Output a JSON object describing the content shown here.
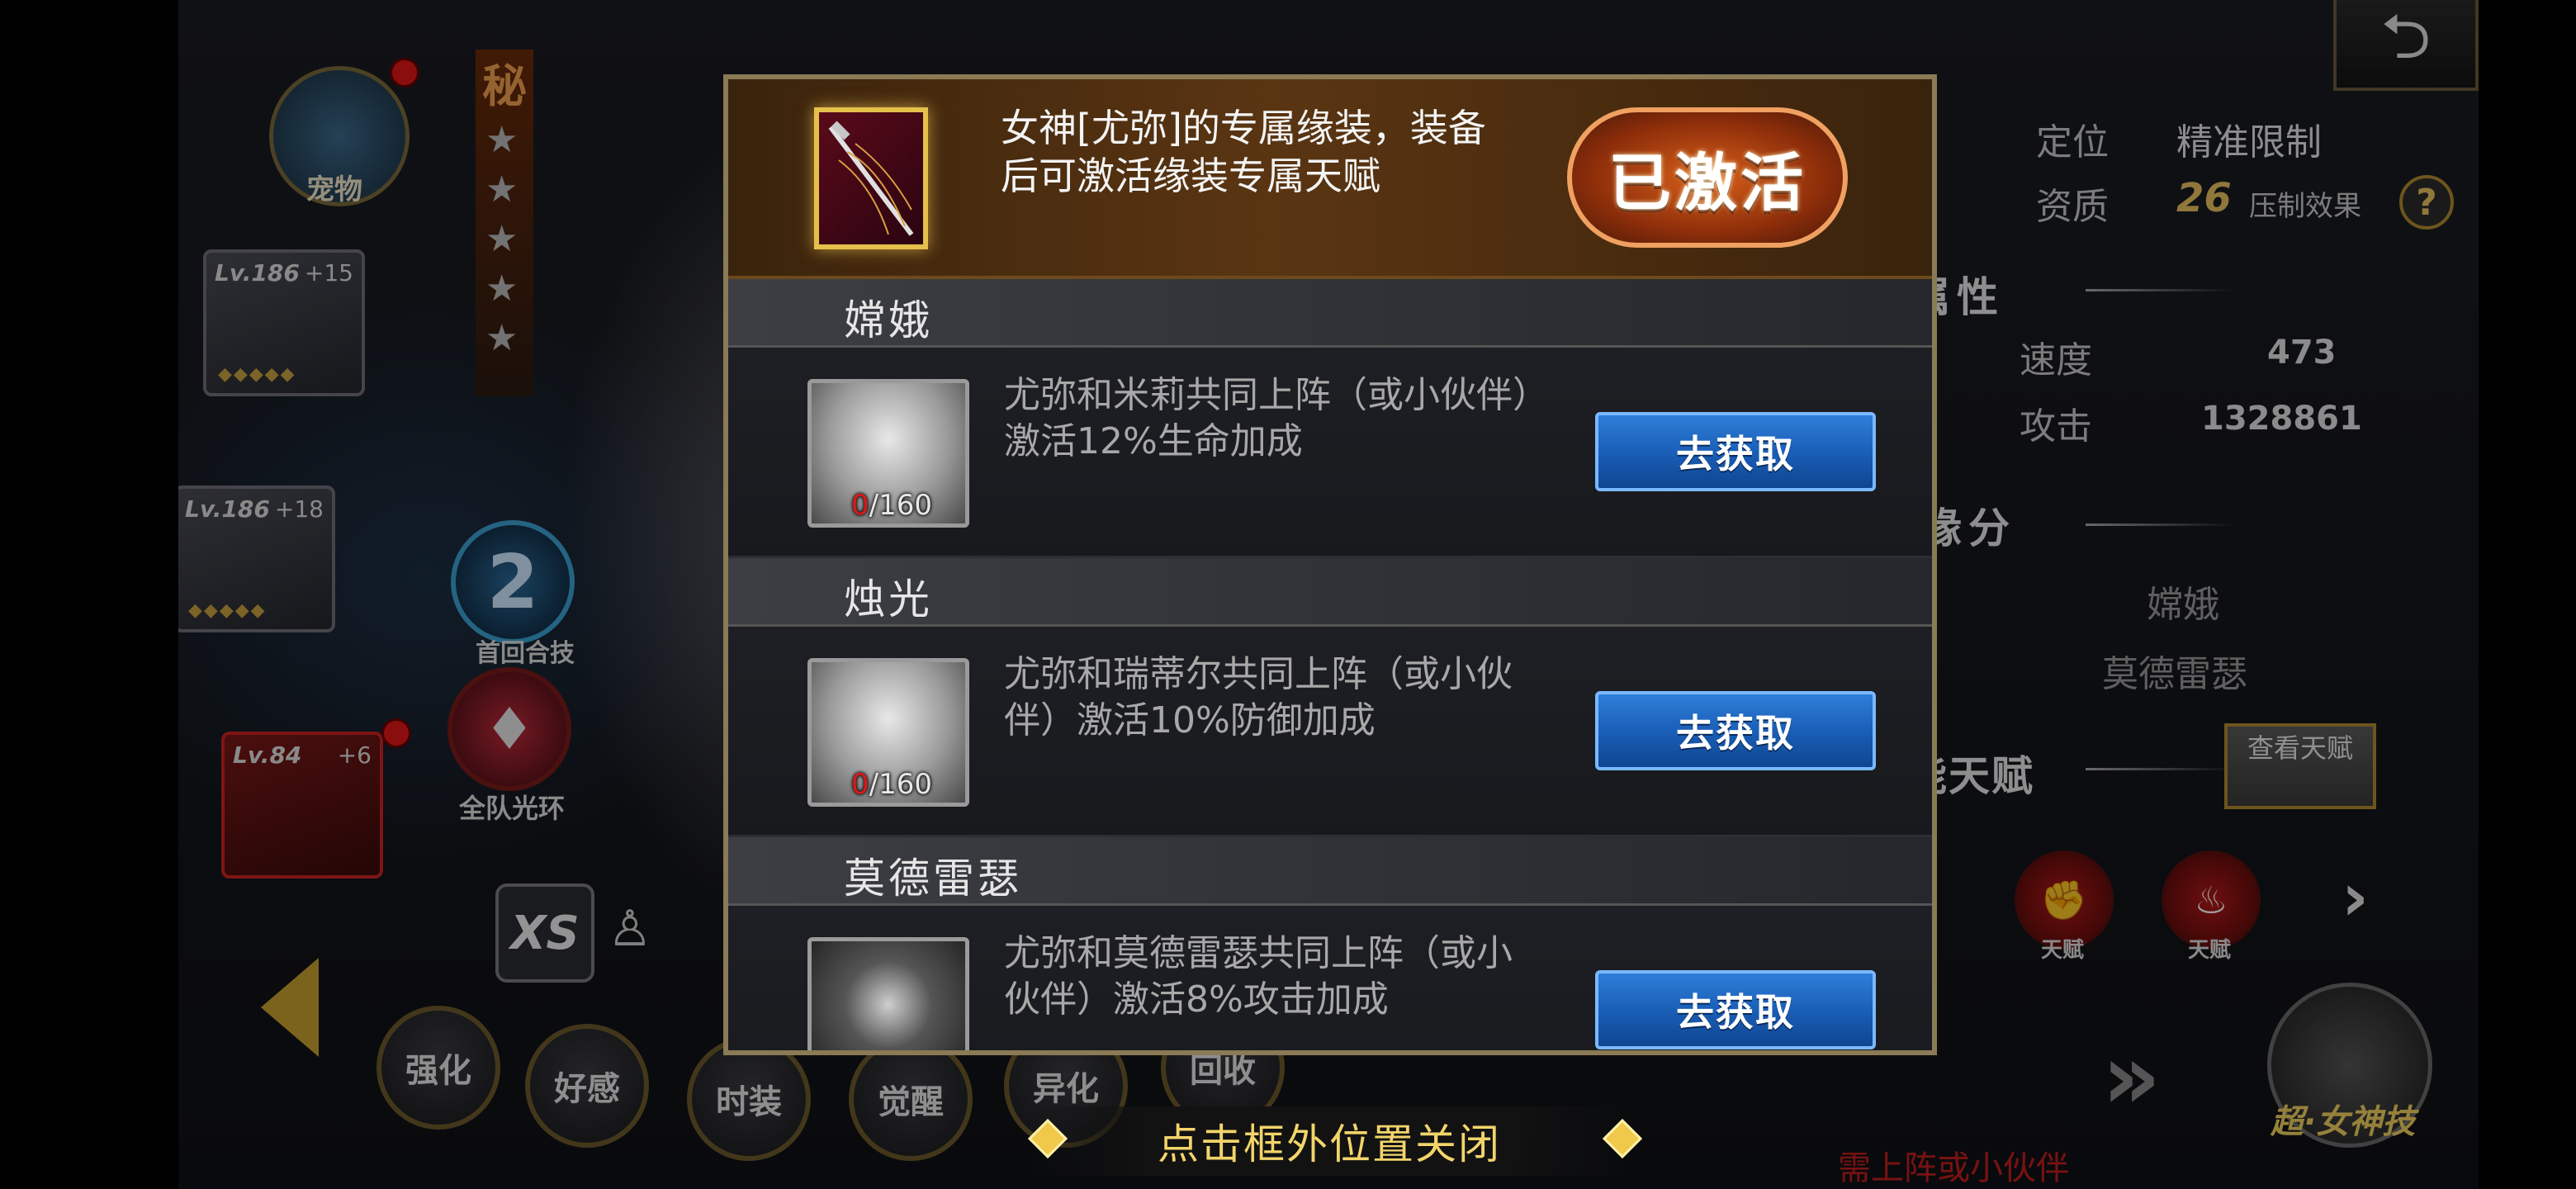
{
  "background": {
    "pet_label": "宠物",
    "secret_char": "秘",
    "equip_slots": [
      {
        "level": "Lv.186",
        "plus": "+15"
      },
      {
        "level": "Lv.186",
        "plus": "+18"
      },
      {
        "level": "Lv.84",
        "plus": "+6"
      }
    ],
    "combo_number": "2",
    "combo_label": "首回合技",
    "aura_label": "全队光环",
    "xs_label": "XS",
    "bottom_tabs": [
      "强化",
      "好感",
      "时装",
      "觉醒",
      "异化",
      "回收"
    ],
    "right_panel": {
      "position_label": "定位",
      "position_value": "精准限制",
      "aptitude_label": "资质",
      "aptitude_value": "26",
      "suppress_label": "压制效果",
      "attr_header": "属性",
      "speed_label": "速度",
      "speed_value": "473",
      "attack_label": "攻击",
      "attack_value": "1328861",
      "fate_header": "缘分",
      "fate_items": [
        "嫦娥",
        "莫德雷瑟"
      ],
      "talent_header": "技能天赋",
      "view_talent": "查看天赋",
      "talent_icon_label": "天赋",
      "ultimate_label": "超·女神技",
      "need_deploy": "需上阵或小伙伴"
    }
  },
  "modal": {
    "top_description": "女神[尤弥]的专属缘装，装备后可激活缘装专属天赋",
    "activated_label": "已激活",
    "groups": [
      {
        "name": "嫦娥",
        "description": "尤弥和米莉共同上阵（或小伙伴）激活12%生命加成",
        "count_have": "0",
        "count_need": "/160",
        "button": "去获取"
      },
      {
        "name": "烛光",
        "description": "尤弥和瑞蒂尔共同上阵（或小伙伴）激活10%防御加成",
        "count_have": "0",
        "count_need": "/160",
        "button": "去获取"
      },
      {
        "name": "莫德雷瑟",
        "description": "尤弥和莫德雷瑟共同上阵（或小伙伴）激活8%攻击加成",
        "count_have": "",
        "count_need": "",
        "button": "去获取"
      }
    ]
  },
  "close_hint": "点击框外位置关闭"
}
